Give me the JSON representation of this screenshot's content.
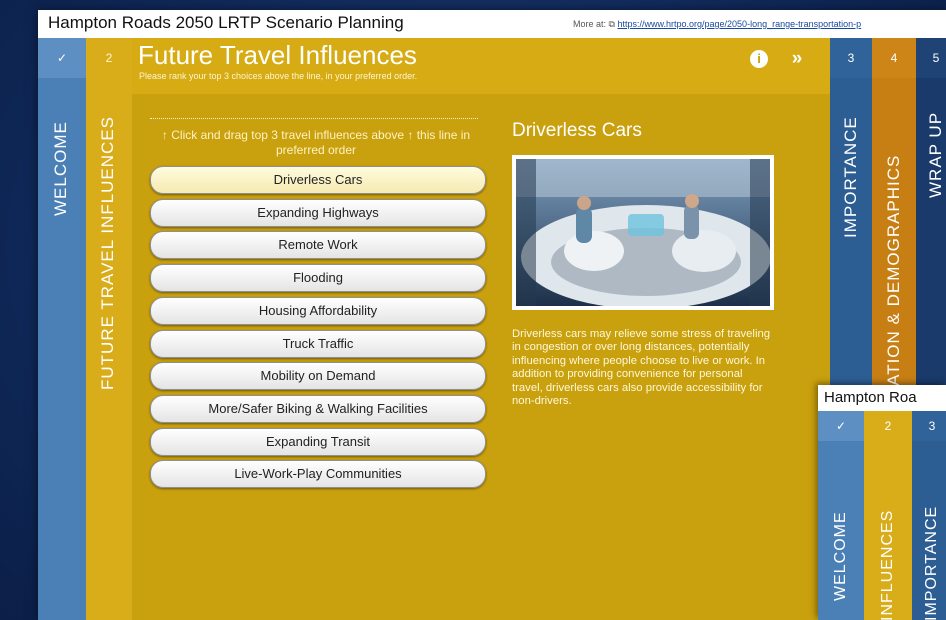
{
  "window": {
    "title": "Hampton Roads 2050 LRTP Scenario Planning",
    "more_label": "More at:",
    "more_link": "https://www.hrtpo.org/page/2050-long_range-transportation-p"
  },
  "tabs": [
    {
      "num": "✓",
      "label": "WELCOME"
    },
    {
      "num": "2",
      "label": "FUTURE TRAVEL INFLUENCES"
    },
    {
      "num": "3",
      "label": "IMPORTANCE"
    },
    {
      "num": "4",
      "label": "TATION & DEMOGRAPHICS"
    },
    {
      "num": "5",
      "label": "WRAP UP"
    }
  ],
  "panel": {
    "title": "Future Travel Influences",
    "subtitle": "Please rank your top 3 choices above the line, in your preferred order.",
    "instruction": "↑ Click and drag top 3 travel influences above ↑ this line in preferred order",
    "items": [
      "Driverless Cars",
      "Expanding Highways",
      "Remote Work",
      "Flooding",
      "Housing Affordability",
      "Truck Traffic",
      "Mobility on Demand",
      "More/Safer Biking & Walking Facilities",
      "Expanding Transit",
      "Live-Work-Play Communities"
    ],
    "selected_index": 0
  },
  "detail": {
    "title": "Driverless Cars",
    "text": "Driverless cars may relieve some stress of traveling in congestion or over long distances, potentially influencing where people choose to live or work. In addition to providing convenience for personal travel, driverless cars also provide accessibility for non-drivers."
  },
  "window2": {
    "title": "Hampton Roa",
    "tabs": [
      {
        "num": "✓",
        "label": "WELCOME"
      },
      {
        "num": "2",
        "label": "INFLUENCES"
      },
      {
        "num": "3",
        "label": "IMPORTANCE"
      }
    ]
  },
  "icons": {
    "info": "info-icon",
    "next": "chevron-double-right-icon"
  },
  "colors": {
    "gold": "#d6ab14",
    "blue": "#3b6fa8",
    "orange": "#c77f14",
    "navy": "#1a3a6b"
  }
}
